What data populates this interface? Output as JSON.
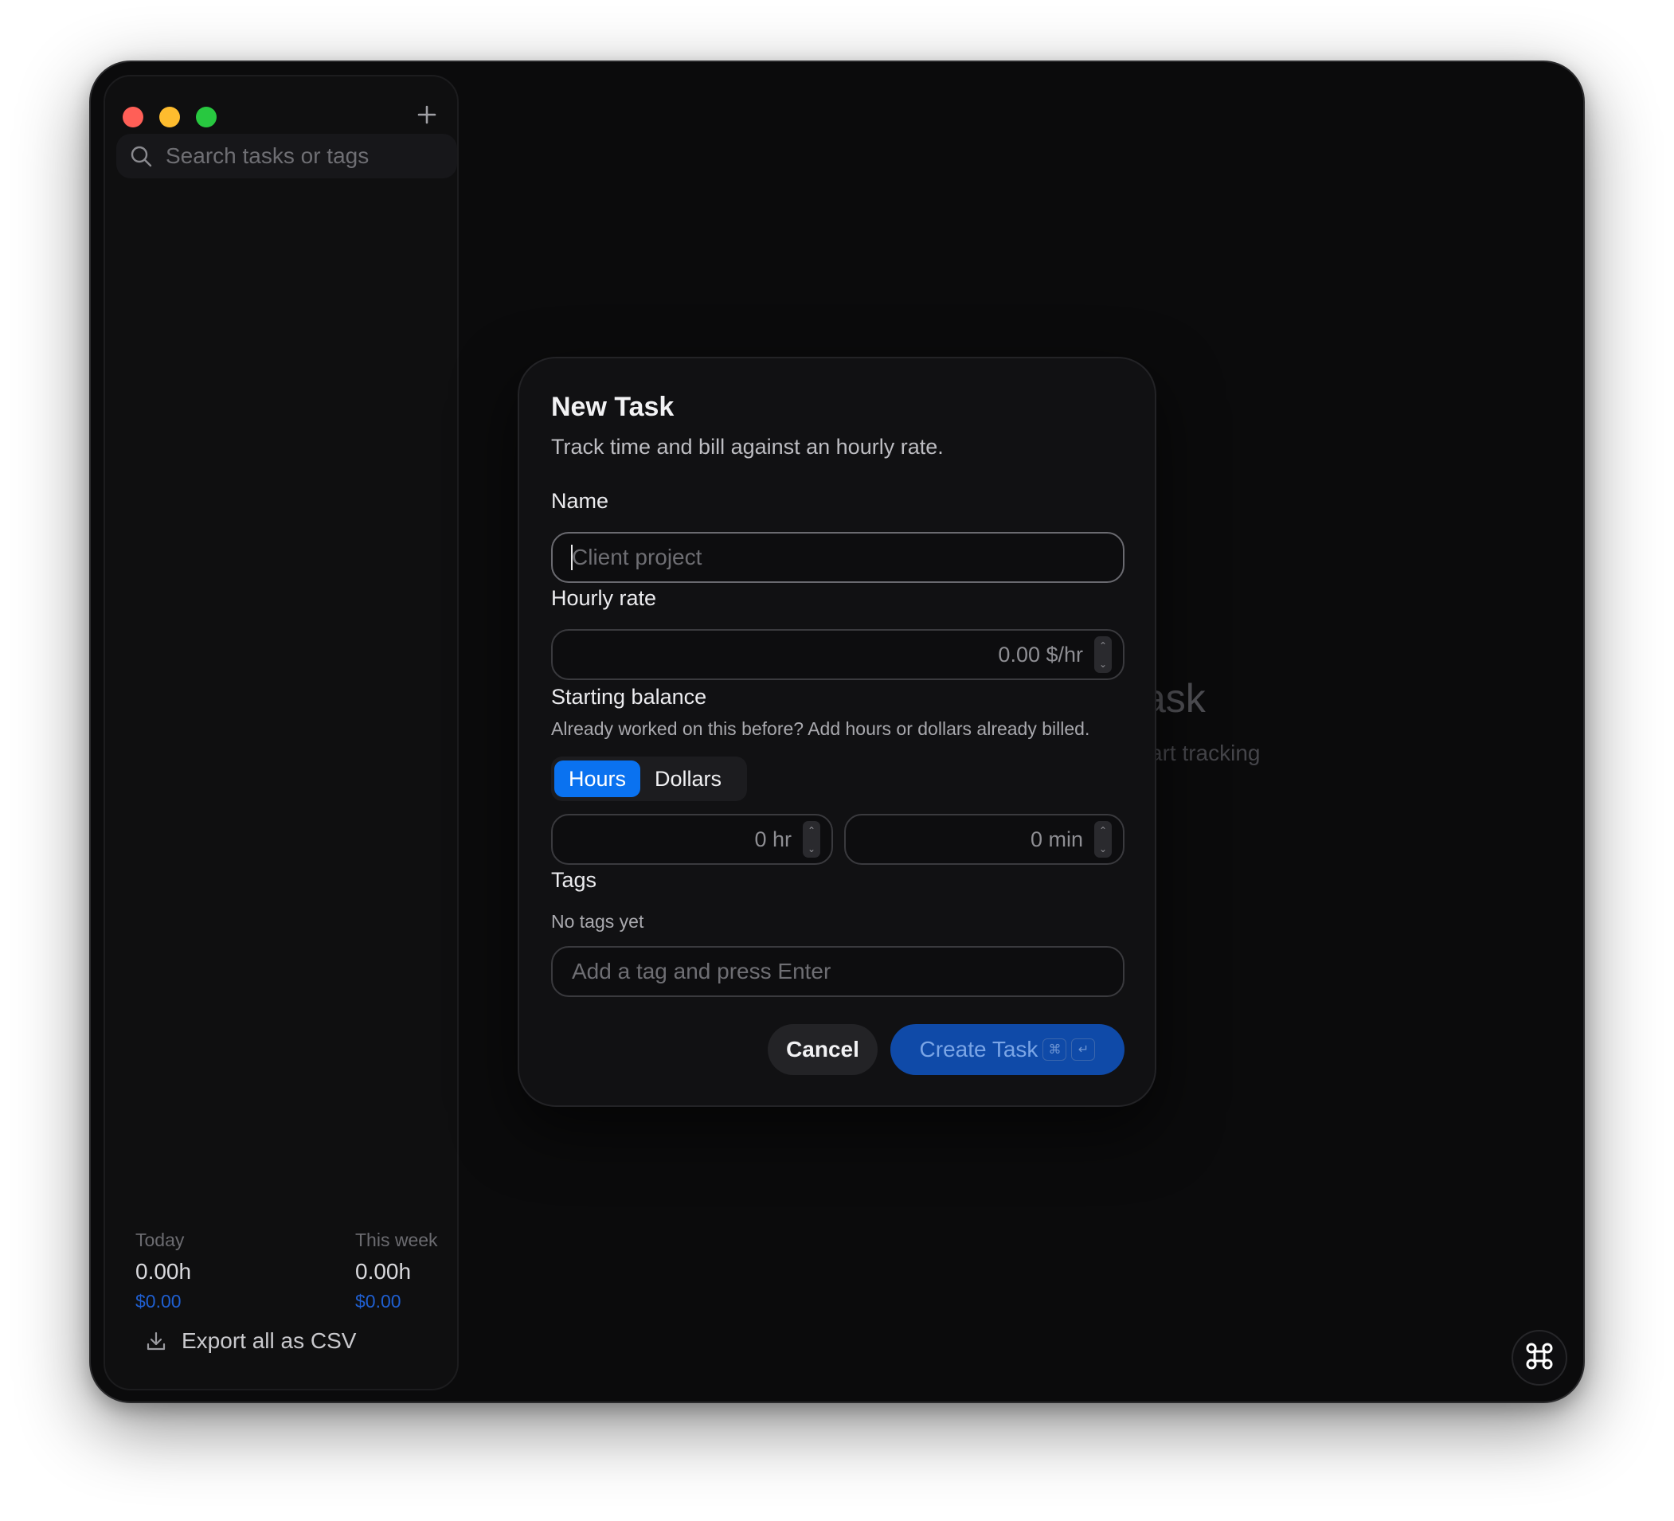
{
  "sidebar": {
    "search_placeholder": "Search tasks or tags",
    "stats": {
      "today_label": "Today",
      "today_hours": "0.00h",
      "today_money": "$0.00",
      "week_label": "This week",
      "week_hours": "0.00h",
      "week_money": "$0.00"
    },
    "export_label": "Export all as CSV"
  },
  "background": {
    "empty_title_partial": "ask",
    "empty_subtitle_partial": "art tracking"
  },
  "modal": {
    "title": "New Task",
    "subtitle": "Track time and bill against an hourly rate.",
    "name_label": "Name",
    "name_placeholder": "Client project",
    "rate_label": "Hourly rate",
    "rate_value": "0.00 $/hr",
    "balance_label": "Starting balance",
    "balance_hint": "Already worked on this before? Add hours or dollars already billed.",
    "segments": [
      "Hours",
      "Dollars"
    ],
    "active_segment": "Hours",
    "hours_value": "0 hr",
    "minutes_value": "0 min",
    "tags_label": "Tags",
    "tags_empty": "No tags yet",
    "tag_placeholder": "Add a tag and press Enter",
    "cancel_label": "Cancel",
    "create_label": "Create Task",
    "shortcut_keys": [
      "⌘",
      "↵"
    ]
  },
  "colors": {
    "accent": "#0a72f0",
    "create_button": "#0f4aa8",
    "money": "#1f5fd1"
  },
  "icons": [
    "plus-icon",
    "search-icon",
    "download-icon",
    "command-icon"
  ]
}
